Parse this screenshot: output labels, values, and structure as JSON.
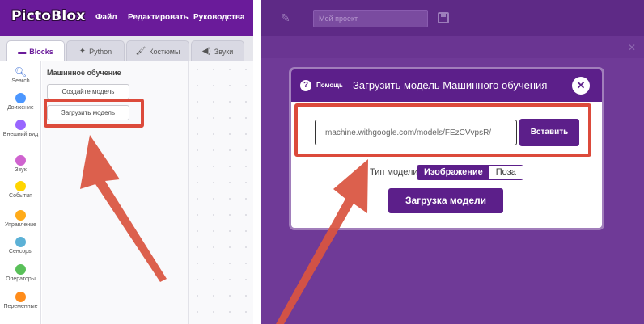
{
  "left": {
    "logo": "PictoBlox",
    "menu": [
      "Файл",
      "Редактировать",
      "Руководства"
    ],
    "tabs": [
      {
        "label": "Blocks",
        "icon": "blocks-icon"
      },
      {
        "label": "Python",
        "icon": "python-icon"
      },
      {
        "label": "Костюмы",
        "icon": "brush-icon"
      },
      {
        "label": "Звуки",
        "icon": "speaker-icon"
      }
    ],
    "categories": [
      {
        "label": "Search",
        "color": "#3c70d6"
      },
      {
        "label": "Движение",
        "color": "#4c97ff"
      },
      {
        "label": "Внешний вид",
        "color": "#9966ff"
      },
      {
        "label": "Звук",
        "color": "#cf63cf"
      },
      {
        "label": "События",
        "color": "#ffd500"
      },
      {
        "label": "Управление",
        "color": "#ffab19"
      },
      {
        "label": "Сенсоры",
        "color": "#5cb1d6"
      },
      {
        "label": "Операторы",
        "color": "#59c059"
      },
      {
        "label": "Переменные",
        "color": "#ff8c1a"
      }
    ],
    "palette": {
      "title": "Машинное обучение",
      "create_button": "Создайте модель",
      "load_button": "Загрузить модель"
    }
  },
  "right": {
    "project_placeholder": "Мой проект",
    "modal": {
      "help_label": "Помощь",
      "title": "Загрузить модель Машинного обучения",
      "close_label": "✕",
      "url_value": "machine.withgoogle.com/models/FEzCVvpsR/",
      "paste_button": "Вставить",
      "model_type_label": "Тип модели:",
      "type_options": [
        "Изображение",
        "Поза"
      ],
      "selected_type": "Изображение",
      "load_button": "Загрузка модели"
    }
  },
  "colors": {
    "brand_purple": "#6a1b9a",
    "modal_purple": "#5c1f8a",
    "highlight_red": "#dc4a3b"
  }
}
